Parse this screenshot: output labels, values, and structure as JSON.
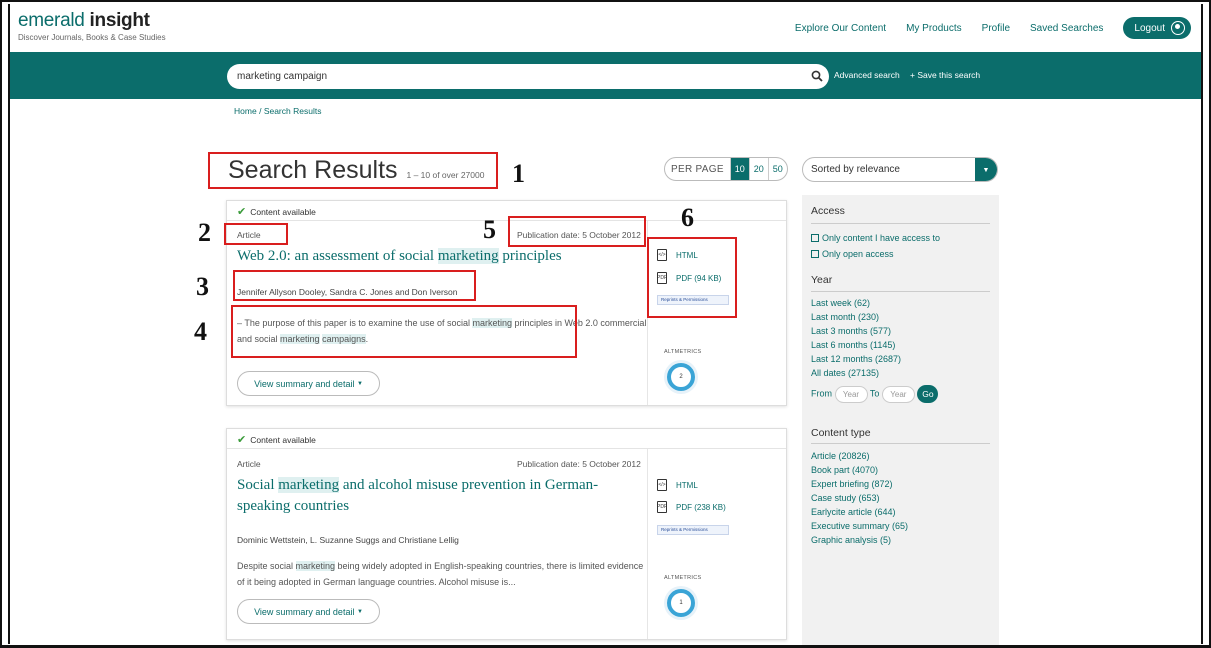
{
  "header": {
    "logo_word1": "emerald",
    "logo_word2": "insight",
    "tagline": "Discover Journals, Books & Case Studies",
    "nav": [
      "Explore Our Content",
      "My Products",
      "Profile",
      "Saved Searches"
    ],
    "logout_label": "Logout",
    "accent_color": "#0b6d6b"
  },
  "search": {
    "value": "marketing campaign",
    "advanced_label": "Advanced search",
    "save_label": "+ Save this search"
  },
  "breadcrumb": {
    "home": "Home",
    "sep": "/",
    "current": "Search Results"
  },
  "results": {
    "title": "Search Results",
    "count": "1 – 10 of over 27000",
    "per_page_label": "PER PAGE",
    "per_page_options": [
      "10",
      "20",
      "50"
    ],
    "per_page_selected": "10",
    "sort_label": "Sorted by relevance"
  },
  "items": [
    {
      "availability": "Content available",
      "type": "Article",
      "pub_date": "Publication date: 5 October 2012",
      "title_parts": [
        "Web 2.0: an assessment of social ",
        "marketing",
        " principles"
      ],
      "authors": "Jennifer Allyson Dooley, Sandra C. Jones and Don Iverson",
      "abstract_parts": [
        "– The purpose of this paper is to examine the use of social ",
        "marketing",
        " principles in Web 2.0 commercial and social ",
        "marketing",
        " ",
        "campaigns",
        "."
      ],
      "html_label": "HTML",
      "pdf_label": "PDF (94 KB)",
      "reprints_label": "Reprints & Permissions",
      "altmetrics_label": "ALTMETRICS",
      "altmetric_score": "2",
      "summary_label": "View summary and detail"
    },
    {
      "availability": "Content available",
      "type": "Article",
      "pub_date": "Publication date: 5 October 2012",
      "title_parts": [
        "Social ",
        "marketing",
        " and alcohol misuse prevention in German-speaking countries"
      ],
      "authors": "Dominic Wettstein, L. Suzanne Suggs and Christiane Lellig",
      "abstract_parts": [
        "Despite social ",
        "marketing",
        " being widely adopted in English-speaking countries, there is limited evidence of it being adopted in German language countries. Alcohol misuse is..."
      ],
      "html_label": "HTML",
      "pdf_label": "PDF (238 KB)",
      "reprints_label": "Reprints & Permissions",
      "altmetrics_label": "ALTMETRICS",
      "altmetric_score": "1",
      "summary_label": "View summary and detail"
    }
  ],
  "filters": {
    "access_heading": "Access",
    "access_options": [
      "Only content I have access to",
      "Only open access"
    ],
    "year_heading": "Year",
    "year_options": [
      "Last week (62)",
      "Last month (230)",
      "Last 3 months (577)",
      "Last 6 months (1145)",
      "Last 12 months (2687)",
      "All dates (27135)"
    ],
    "from_label": "From",
    "to_label": "To",
    "year_placeholder": "Year",
    "go_label": "Go",
    "content_type_heading": "Content type",
    "content_types": [
      "Article (20826)",
      "Book part (4070)",
      "Expert briefing (872)",
      "Case study (653)",
      "Earlycite article (644)",
      "Executive summary (65)",
      "Graphic analysis (5)"
    ]
  },
  "annotations": [
    "1",
    "2",
    "3",
    "4",
    "5",
    "6"
  ]
}
